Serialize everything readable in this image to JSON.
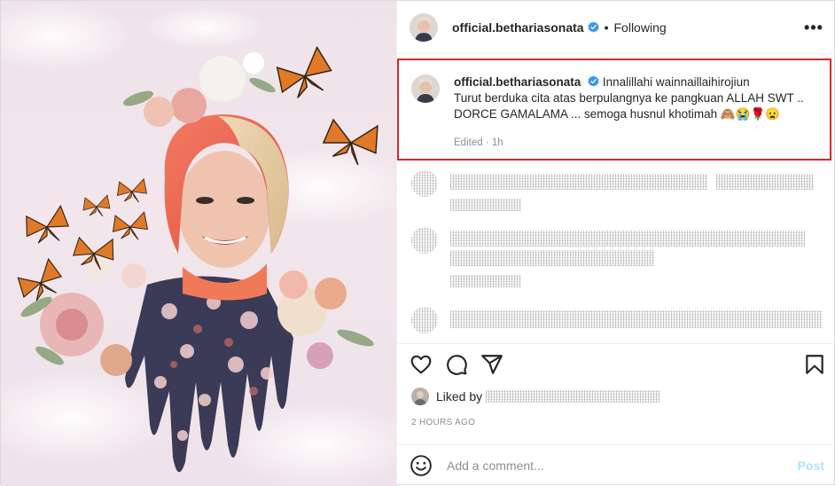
{
  "post": {
    "author": "official.bethariasonata",
    "follow_separator": "•",
    "follow_status": "Following",
    "more_icon": "more-horizontal-icon",
    "more_glyph": "•••"
  },
  "caption": {
    "username": "official.bethariasonata",
    "text_line1": "Innalillahi wainnaillaihirojiun",
    "text_line2": "Turut berduka cita atas berpulangnya ke pangkuan ALLAH SWT ..",
    "text_line3": "DORCE GAMALAMA ... semoga husnul khotimah 🙈😭🌹😦",
    "meta": "Edited · 1h"
  },
  "actions": {
    "like_icon": "heart-icon",
    "comment_icon": "comment-icon",
    "share_icon": "send-icon",
    "save_icon": "bookmark-icon"
  },
  "likes": {
    "prefix": "Liked by"
  },
  "timestamp": "2 HOURS AGO",
  "add_comment": {
    "placeholder": "Add a comment...",
    "post_label": "Post"
  },
  "colors": {
    "highlight_border": "#d8262d",
    "verified": "#3897f0",
    "post_disabled": "#b2dffc",
    "muted": "#8e8e8e"
  }
}
